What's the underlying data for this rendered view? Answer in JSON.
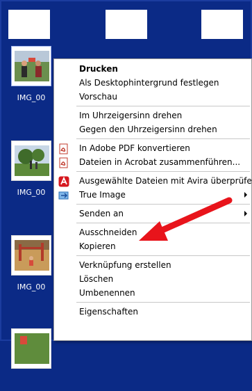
{
  "explorer": {
    "thumbnails": [
      {
        "label": "IMG_00",
        "scene": "people at festival"
      },
      {
        "label": "IMG_00",
        "scene": "trees and field"
      },
      {
        "label": "IMG_00",
        "scene": "child on playground"
      },
      {
        "label": "",
        "scene": "green outdoor"
      }
    ]
  },
  "context_menu": {
    "groups": [
      [
        {
          "label": "Drucken",
          "bold": true
        },
        {
          "label": "Als Desktophintergrund festlegen"
        },
        {
          "label": "Vorschau"
        }
      ],
      [
        {
          "label": "Im Uhrzeigersinn drehen"
        },
        {
          "label": "Gegen den Uhrzeigersinn drehen"
        }
      ],
      [
        {
          "label": "In Adobe PDF konvertieren",
          "icon": "adobe-pdf-icon"
        },
        {
          "label": "Dateien in Acrobat zusammenführen...",
          "icon": "acrobat-combine-icon"
        }
      ],
      [
        {
          "label": "Ausgewählte Dateien mit Avira überprüfen",
          "icon": "avira-icon"
        },
        {
          "label": "True Image",
          "icon": "true-image-icon",
          "submenu": true
        }
      ],
      [
        {
          "label": "Senden an",
          "submenu": true
        }
      ],
      [
        {
          "label": "Ausschneiden"
        },
        {
          "label": "Kopieren"
        }
      ],
      [
        {
          "label": "Verknüpfung erstellen"
        },
        {
          "label": "Löschen"
        },
        {
          "label": "Umbenennen"
        }
      ],
      [
        {
          "label": "Eigenschaften"
        }
      ]
    ]
  },
  "annotation": {
    "color": "#e8141b",
    "points_to": "Umbenennen"
  }
}
